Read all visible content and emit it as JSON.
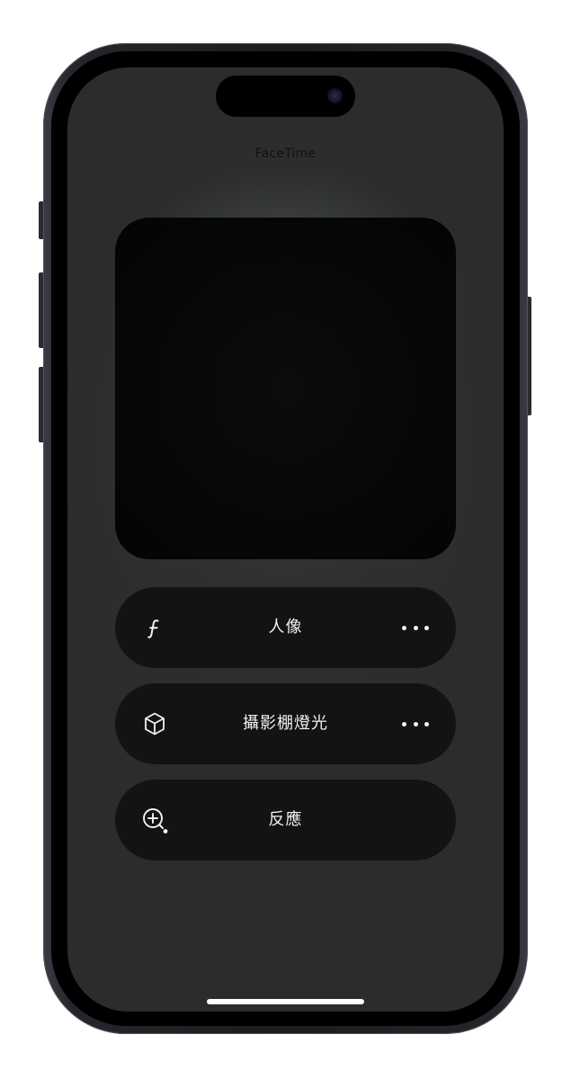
{
  "app": {
    "title": "FaceTime"
  },
  "video_effects": {
    "items": [
      {
        "label": "人像",
        "icon": "f-aperture-icon",
        "has_more": true
      },
      {
        "label": "攝影棚燈光",
        "icon": "cube-icon",
        "has_more": true
      },
      {
        "label": "反應",
        "icon": "zoom-plus-icon",
        "has_more": false
      }
    ]
  },
  "colors": {
    "screen_background": "#2b2c2c",
    "pill_background": "#131313",
    "preview_background": "#050606",
    "pill_text": "#f2f2f2"
  }
}
